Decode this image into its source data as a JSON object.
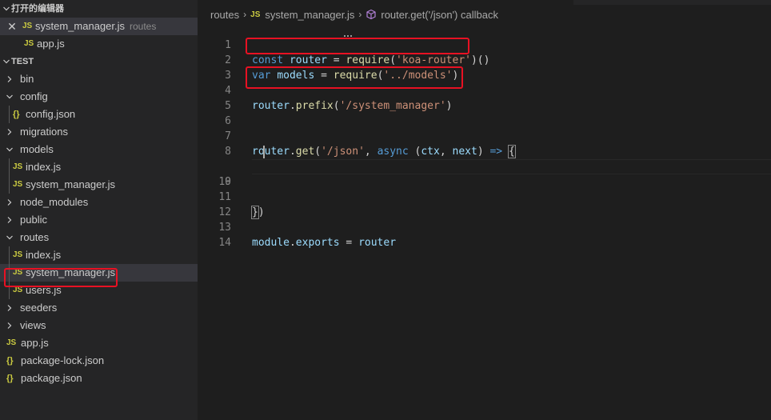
{
  "sidebar": {
    "open_editors_title": "打开的编辑器",
    "open_editors": [
      {
        "icon": "JS",
        "name": "system_manager.js",
        "description": "routes",
        "closable": true
      },
      {
        "icon": "JS",
        "name": "app.js",
        "description": ""
      }
    ],
    "workspace_title": "TEST",
    "tree": [
      {
        "name": "bin"
      },
      {
        "name": "config"
      },
      {
        "icon": "{}",
        "name": "config.json"
      },
      {
        "name": "migrations"
      },
      {
        "name": "models"
      },
      {
        "icon": "JS",
        "name": "index.js"
      },
      {
        "icon": "JS",
        "name": "system_manager.js"
      },
      {
        "name": "node_modules"
      },
      {
        "name": "public"
      },
      {
        "name": "routes"
      },
      {
        "icon": "JS",
        "name": "index.js"
      },
      {
        "icon": "JS",
        "name": "system_manager.js"
      },
      {
        "icon": "JS",
        "name": "users.js"
      },
      {
        "name": "seeders"
      },
      {
        "name": "views"
      },
      {
        "icon": "JS",
        "name": "app.js"
      },
      {
        "icon": "{}",
        "name": "package-lock.json"
      },
      {
        "icon": "{}",
        "name": "package.json"
      }
    ]
  },
  "breadcrumb": {
    "folder": "routes",
    "file_icon": "JS",
    "file": "system_manager.js",
    "symbol": "router.get('/json') callback"
  },
  "code": {
    "line_numbers": [
      "1",
      "2",
      "3",
      "4",
      "5",
      "6",
      "7",
      "8",
      "9",
      "10",
      "11",
      "12",
      "13",
      "14"
    ],
    "l1": {
      "kw": "const",
      "var": "router",
      "eq": " = ",
      "fn": "require",
      "open": "(",
      "str": "'koa-router'",
      "close": ")()"
    },
    "l2": {
      "kw": "var",
      "var": "models",
      "eq": " = ",
      "fn": "require",
      "open": "(",
      "str": "'../models'",
      "close": ")"
    },
    "l4": {
      "obj": "router",
      "dot": ".",
      "fn": "prefix",
      "open": "(",
      "str": "'/system_manager'",
      "close": ")"
    },
    "l7": {
      "obj": "router",
      "dot": ".",
      "fn": "get",
      "open": "(",
      "str": "'/json'",
      "comma": ", ",
      "kw": "async",
      "p_open": " (",
      "p1": "ctx",
      "p_comma": ", ",
      "p2": "next",
      "p_close": ") ",
      "arrow": "=>",
      "brace": "{"
    },
    "l11": {
      "brace": "}",
      "close": ")"
    },
    "l13": {
      "obj": "module",
      "dot": ".",
      "prop": "exports",
      "eq": " = ",
      "val": "router"
    }
  },
  "colors": {
    "highlight": "#e81123",
    "js_icon": "#cbcb41",
    "keyword": "#569cd6",
    "variable": "#9cdcfe",
    "function": "#dcdcaa",
    "string": "#ce9178"
  }
}
